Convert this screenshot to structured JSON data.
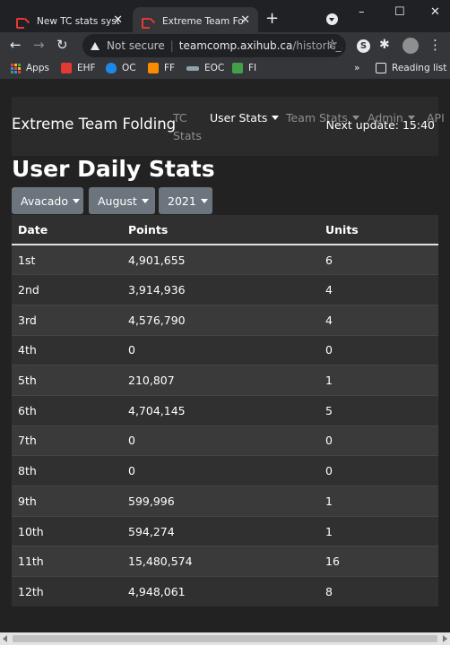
{
  "browser": {
    "tabs": [
      {
        "title": "New TC stats system",
        "active": false
      },
      {
        "title": "Extreme Team Folding",
        "active": true
      }
    ],
    "new_tab": "+",
    "window_controls": {
      "minimize": "–",
      "maximize": "☐",
      "close": "✕"
    },
    "address": {
      "security_label": "Not secure",
      "separator": "|",
      "host": "teamcomp.axihub.ca",
      "path": "/historic_..."
    },
    "extension_label": "S",
    "bookmarks": [
      {
        "label": "Apps",
        "icon": "apps-grid-icon"
      },
      {
        "label": "EHF",
        "icon": "ehf-logo-icon",
        "color": "#e53935"
      },
      {
        "label": "OC",
        "icon": "oc-logo-icon",
        "color": "#1e88e5"
      },
      {
        "label": "FF",
        "icon": "ff-logo-icon",
        "color": "#fb8c00"
      },
      {
        "label": "EOC",
        "icon": "eoc-logo-icon",
        "color": "#90a4ae"
      },
      {
        "label": "FI",
        "icon": "fi-logo-icon",
        "color": "#43a047"
      }
    ],
    "bookmarks_overflow": "»",
    "reading_list": "Reading list"
  },
  "navbar": {
    "brand": "Extreme Team Folding",
    "items": [
      {
        "label": "TC",
        "label2": "Stats",
        "active": false,
        "dropdown": false
      },
      {
        "label": "User Stats",
        "active": true,
        "dropdown": true
      },
      {
        "label": "Team Stats",
        "active": false,
        "dropdown": true
      },
      {
        "label": "Admin",
        "active": false,
        "dropdown": true
      },
      {
        "label": "API",
        "active": false,
        "dropdown": false
      }
    ],
    "next_update": "Next update: 15:40"
  },
  "page": {
    "title": "User Daily Stats",
    "filters": {
      "user": "Avacado",
      "month": "August",
      "year": "2021"
    }
  },
  "table": {
    "headers": [
      "Date",
      "Points",
      "Units"
    ],
    "rows": [
      [
        "1st",
        "4,901,655",
        "6"
      ],
      [
        "2nd",
        "3,914,936",
        "4"
      ],
      [
        "3rd",
        "4,576,790",
        "4"
      ],
      [
        "4th",
        "0",
        "0"
      ],
      [
        "5th",
        "210,807",
        "1"
      ],
      [
        "6th",
        "4,704,145",
        "5"
      ],
      [
        "7th",
        "0",
        "0"
      ],
      [
        "8th",
        "0",
        "0"
      ],
      [
        "9th",
        "599,996",
        "1"
      ],
      [
        "10th",
        "594,274",
        "1"
      ],
      [
        "11th",
        "15,480,574",
        "16"
      ],
      [
        "12th",
        "4,948,061",
        "8"
      ]
    ]
  }
}
